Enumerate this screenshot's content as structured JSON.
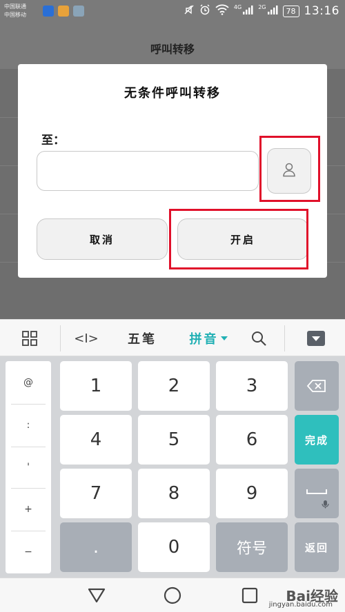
{
  "status_bar": {
    "carrier_1": "中国联通",
    "carrier_2": "中国移动",
    "network_1": "4G",
    "network_2": "2G",
    "battery": "78",
    "time": "13:16"
  },
  "page": {
    "title": "呼叫转移"
  },
  "dialog": {
    "title": "无条件呼叫转移",
    "to_label": "至：",
    "number_value": "",
    "cancel_label": "取消",
    "open_label": "开启",
    "contact_icon": "person-icon"
  },
  "keyboard": {
    "toolbar": {
      "grid_icon": "grid-icon",
      "cursor_label": "<I>",
      "wubi_label": "五笔",
      "pinyin_label": "拼音",
      "search_icon": "search-icon",
      "hide_icon": "hide-keyboard-icon"
    },
    "symbols": [
      "@",
      ":",
      "'",
      "+",
      "−"
    ],
    "digits": [
      "1",
      "2",
      "3",
      "4",
      "5",
      "6",
      "7",
      "8",
      "9"
    ],
    "bottom_row": {
      "dot": ".",
      "zero": "0",
      "symbols": "符号"
    },
    "func": {
      "done": "完成",
      "back": "返回"
    },
    "accent_color": "#2fbfbd"
  },
  "watermark": {
    "brand": "Bai经验",
    "url": "jingyan.baidu.com"
  }
}
